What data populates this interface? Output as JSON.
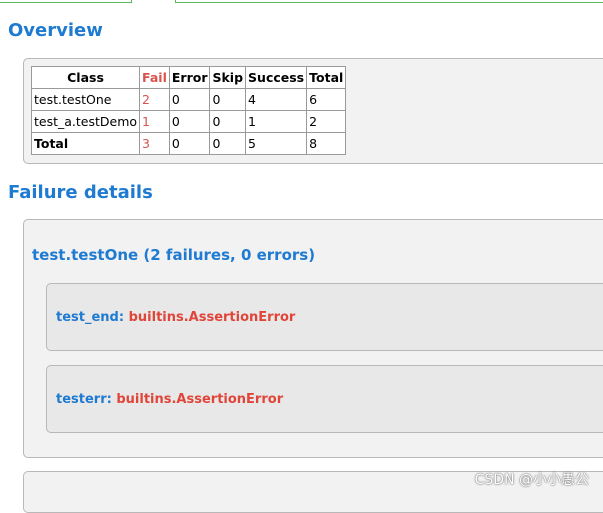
{
  "headings": {
    "overview": "Overview",
    "failure_details": "Failure details"
  },
  "summary_table": {
    "headers": [
      "Class",
      "Fail",
      "Error",
      "Skip",
      "Success",
      "Total"
    ],
    "rows": [
      {
        "class": "test.testOne",
        "fail": "2",
        "error": "0",
        "skip": "0",
        "success": "4",
        "total": "6"
      },
      {
        "class": "test_a.testDemo",
        "fail": "1",
        "error": "0",
        "skip": "0",
        "success": "1",
        "total": "2"
      },
      {
        "class": "Total",
        "fail": "3",
        "error": "0",
        "skip": "0",
        "success": "5",
        "total": "8"
      }
    ]
  },
  "failure_group": {
    "title": "test.testOne (2 failures, 0 errors)",
    "cases": [
      {
        "name": "test_end:",
        "error": "builtins.AssertionError"
      },
      {
        "name": "testerr:",
        "error": "builtins.AssertionError"
      }
    ]
  },
  "watermark": "CSDN @小小愚公",
  "colors": {
    "heading_blue": "#1f7ad1",
    "fail_red": "#d9534f",
    "error_red": "#e0453a",
    "panel_bg": "#f2f2f2",
    "tab_green": "#5cb85c"
  }
}
